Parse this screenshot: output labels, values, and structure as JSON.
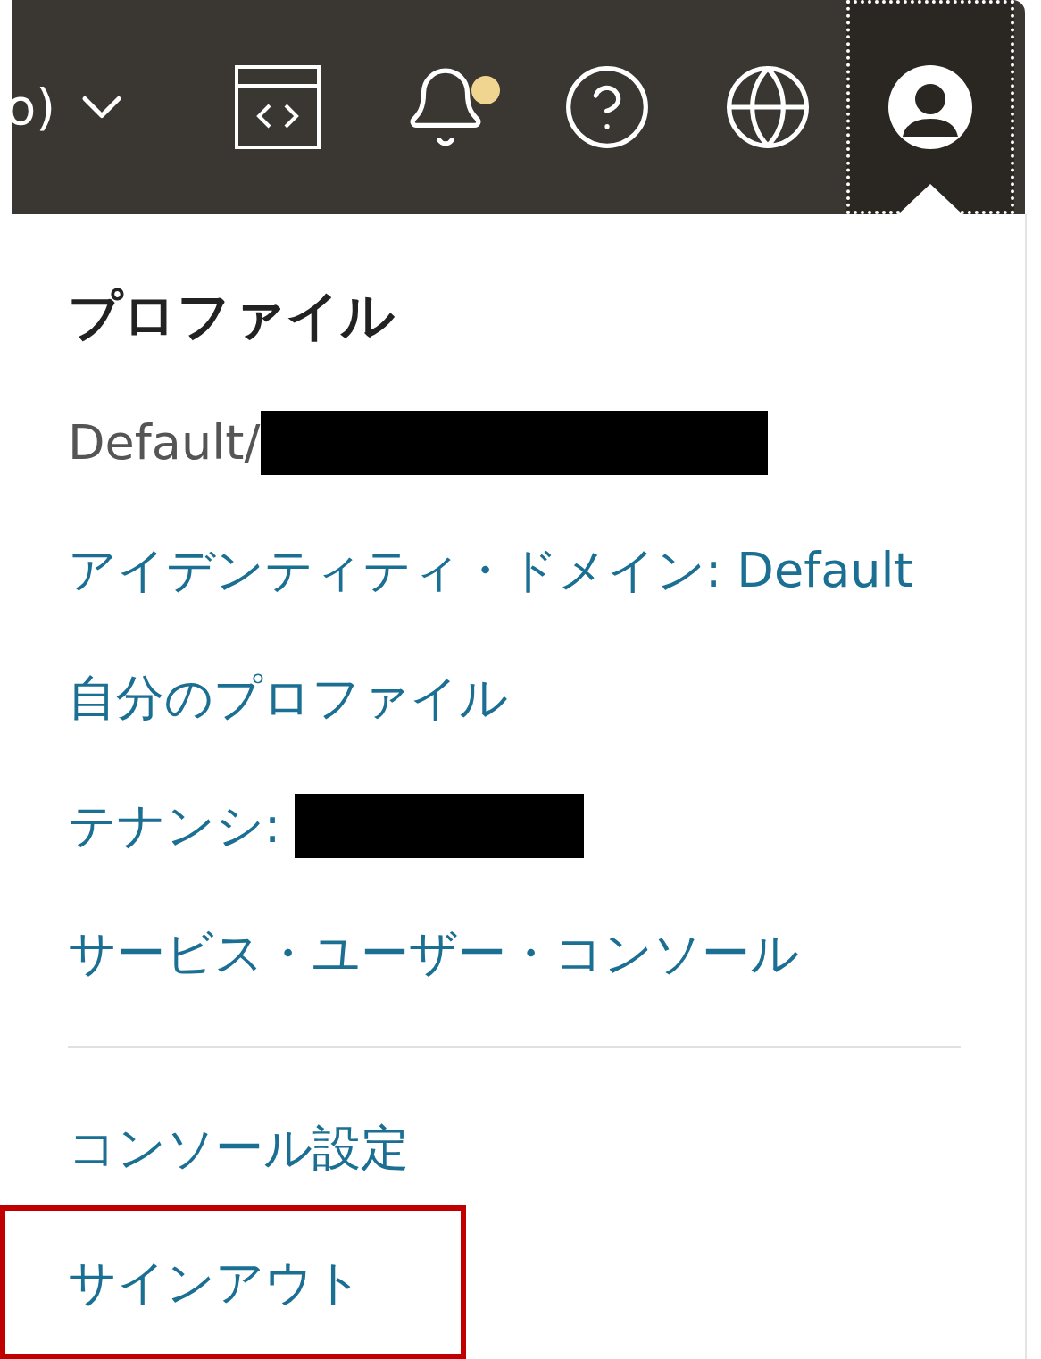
{
  "header": {
    "region_fragment": "o)",
    "notification_dot": true
  },
  "menu": {
    "title": "プロファイル",
    "items": [
      {
        "text": "Default/",
        "kind": "text",
        "redacted": true,
        "highlighted": false
      },
      {
        "text": "アイデンティティ・ドメイン: Default",
        "kind": "link",
        "redacted": false,
        "highlighted": false
      },
      {
        "text": "自分のプロファイル",
        "kind": "link",
        "redacted": false,
        "highlighted": false
      },
      {
        "text": "テナンシ:",
        "kind": "link",
        "redacted": true,
        "highlighted": false
      },
      {
        "text": "サービス・ユーザー・コンソール",
        "kind": "link",
        "redacted": false,
        "highlighted": false
      },
      {
        "text": "コンソール設定",
        "kind": "link",
        "redacted": false,
        "highlighted": false
      },
      {
        "text": "サインアウト",
        "kind": "link",
        "redacted": false,
        "highlighted": true
      }
    ]
  }
}
